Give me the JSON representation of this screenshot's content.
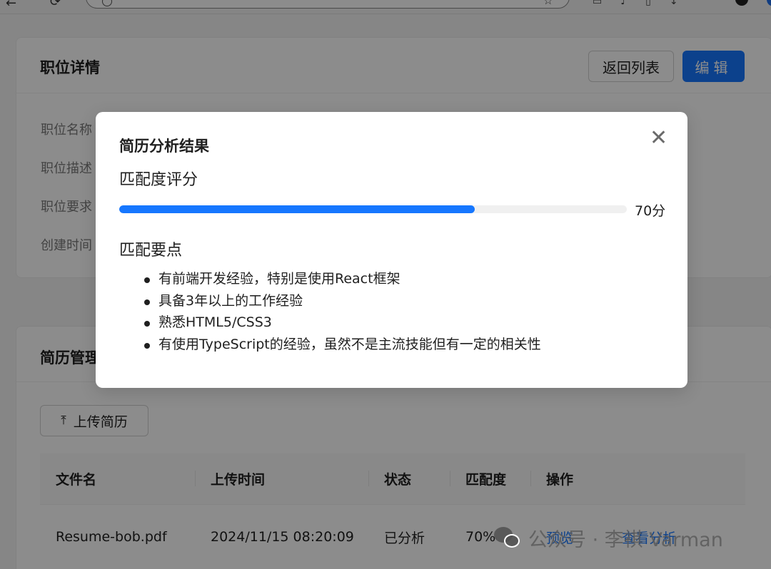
{
  "job_card": {
    "title": "职位详情",
    "back_label": "返回列表",
    "edit_label": "编辑",
    "fields": [
      "职位名称",
      "职位描述",
      "职位要求",
      "创建时间"
    ]
  },
  "resume_card": {
    "title": "简历管理",
    "upload_label": "上传简历",
    "columns": [
      "文件名",
      "上传时间",
      "状态",
      "匹配度",
      "操作"
    ],
    "rows": [
      {
        "file": "Resume-bob.pdf",
        "time": "2024/11/15 08:20:09",
        "status": "已分析",
        "match": "70%",
        "action_preview": "预览",
        "action_view": "查看分析"
      }
    ]
  },
  "modal": {
    "title": "简历分析结果",
    "score_title": "匹配度评分",
    "score": 70,
    "score_text": "70分",
    "points_title": "匹配要点",
    "points": [
      "有前端开发经验，特别是使用React框架",
      "具备3年以上的工作经验",
      "熟悉HTML5/CSS3",
      "有使用TypeScript的经验，虽然不是主流技能但有一定的相关性"
    ]
  },
  "watermark": {
    "text": "公众号 · 李祺 Varman"
  },
  "colors": {
    "primary": "#1677ff",
    "mask": "rgba(0,0,0,0.45)"
  }
}
